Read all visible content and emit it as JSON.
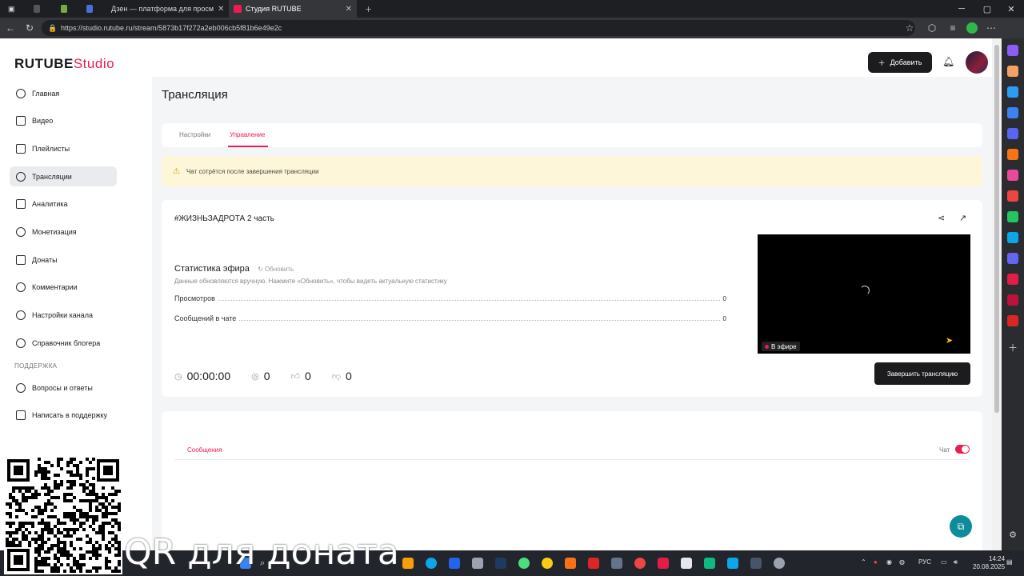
{
  "browser": {
    "tabs": [
      {
        "label": "Дзен — платформа для просм",
        "active": false
      },
      {
        "label": "Студия RUTUBE",
        "active": true
      }
    ],
    "url": "https://studio.rutube.ru/stream/5873b17f272a2eb006cb5f81b6e49e2c"
  },
  "header": {
    "logo_main": "RUTUBE",
    "logo_sub": "Studio",
    "add_button": "Добавить"
  },
  "sidebar": {
    "items": [
      {
        "label": "Главная",
        "icon": "home-icon"
      },
      {
        "label": "Видео",
        "icon": "video-icon"
      },
      {
        "label": "Плейлисты",
        "icon": "playlist-icon"
      },
      {
        "label": "Трансляции",
        "icon": "broadcast-icon",
        "active": true
      },
      {
        "label": "Аналитика",
        "icon": "analytics-icon"
      },
      {
        "label": "Монетизация",
        "icon": "money-icon"
      },
      {
        "label": "Донаты",
        "icon": "donate-icon"
      },
      {
        "label": "Комментарии",
        "icon": "comments-icon"
      },
      {
        "label": "Настройки канала",
        "icon": "settings-icon"
      },
      {
        "label": "Справочник блогера",
        "icon": "info-icon"
      }
    ],
    "support_heading": "ПОДДЕРЖКА",
    "support_items": [
      {
        "label": "Вопросы и ответы",
        "icon": "question-icon"
      },
      {
        "label": "Написать в поддержку",
        "icon": "mail-icon"
      }
    ]
  },
  "main": {
    "page_title": "Трансляция",
    "tabs": [
      {
        "label": "Настройки",
        "active": false
      },
      {
        "label": "Управление",
        "active": true
      }
    ],
    "notice": "Чат сотрётся после завершения трансляции",
    "stream": {
      "title": "#ЖИЗНЬЗАДРОТА 2 часть",
      "stats_title": "Статистика эфира",
      "refresh_label": "Обновить",
      "stats_hint": "Данные обновляются вручную. Нажмите «Обновить», чтобы видеть актуальную статистику",
      "stats": [
        {
          "label": "Просмотров",
          "value": "0"
        },
        {
          "label": "Сообщений в чате",
          "value": "0"
        }
      ],
      "duration": "00:00:00",
      "viewers": "0",
      "likes": "0",
      "dislikes": "0",
      "live_badge": "В эфире",
      "end_button": "Завершить трансляцию"
    },
    "chat": {
      "tab_label": "Сообщения",
      "toggle_label": "Чат",
      "toggle_on": true
    }
  },
  "taskbar": {
    "lang": "РУС",
    "time": "14:24",
    "date": "20.08.2025"
  },
  "overlay": {
    "text": "QR для доната"
  },
  "colors": {
    "accent": "#ed1c4f",
    "dark_button": "#1c1c1f",
    "notice_bg": "#fdf6d9",
    "content_bg": "#f4f5f7"
  }
}
